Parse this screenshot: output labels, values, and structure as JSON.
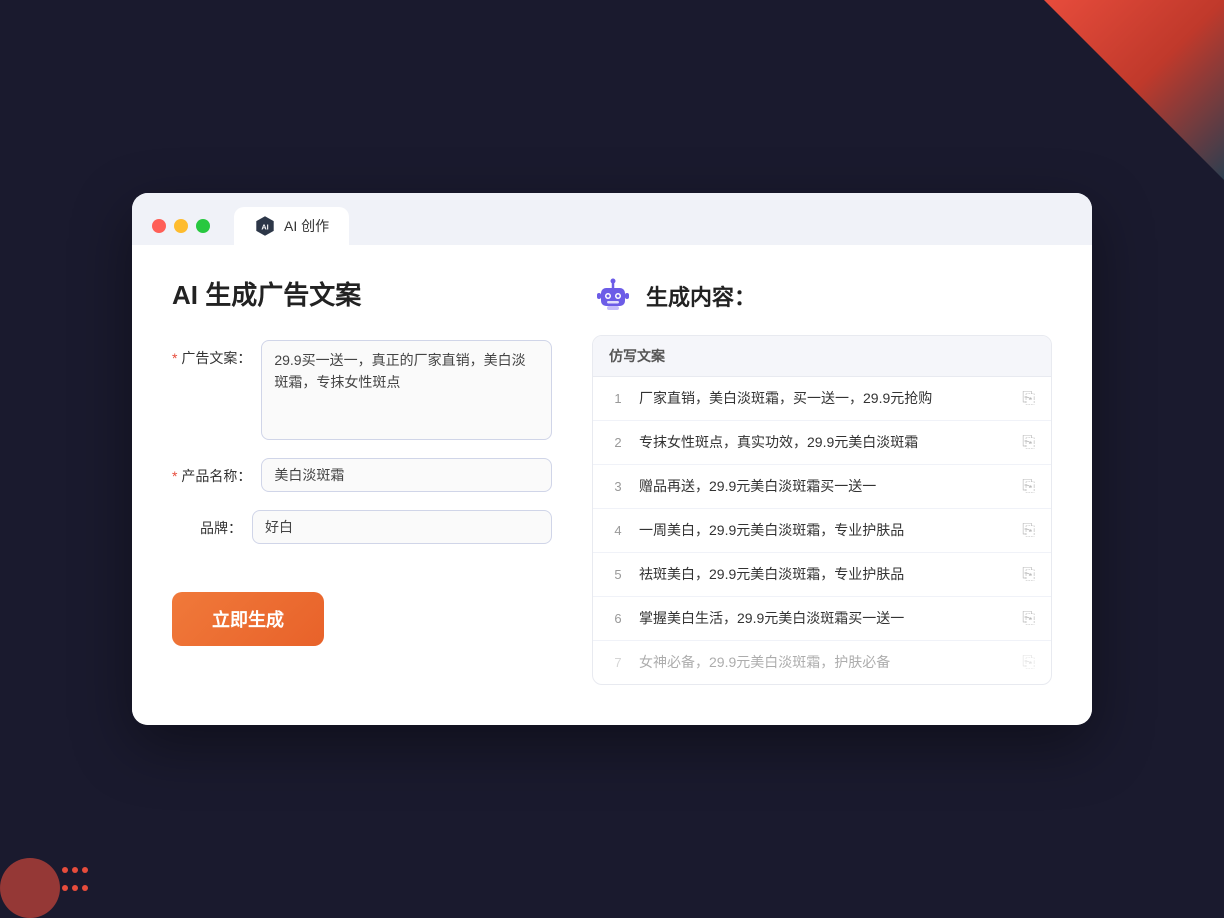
{
  "background": {
    "color": "#1a1a2e"
  },
  "browser": {
    "tab": {
      "label": "AI 创作"
    }
  },
  "page": {
    "title": "AI 生成广告文案",
    "form": {
      "ad_copy_label": "广告文案：",
      "ad_copy_required": "＊",
      "ad_copy_value": "29.9买一送一，真正的厂家直销，美白淡斑霜，专抹女性斑点",
      "product_name_label": "产品名称：",
      "product_name_required": "＊",
      "product_name_value": "美白淡斑霜",
      "brand_label": "品牌：",
      "brand_value": "好白",
      "generate_button": "立即生成"
    },
    "result": {
      "header_icon": "robot",
      "header_title": "生成内容：",
      "column_label": "仿写文案",
      "items": [
        {
          "num": "1",
          "text": "厂家直销，美白淡斑霜，买一送一，29.9元抢购",
          "faded": false
        },
        {
          "num": "2",
          "text": "专抹女性斑点，真实功效，29.9元美白淡斑霜",
          "faded": false
        },
        {
          "num": "3",
          "text": "赠品再送，29.9元美白淡斑霜买一送一",
          "faded": false
        },
        {
          "num": "4",
          "text": "一周美白，29.9元美白淡斑霜，专业护肤品",
          "faded": false
        },
        {
          "num": "5",
          "text": "祛斑美白，29.9元美白淡斑霜，专业护肤品",
          "faded": false
        },
        {
          "num": "6",
          "text": "掌握美白生活，29.9元美白淡斑霜买一送一",
          "faded": false
        },
        {
          "num": "7",
          "text": "女神必备，29.9元美白淡斑霜，护肤必备",
          "faded": true
        }
      ]
    }
  }
}
